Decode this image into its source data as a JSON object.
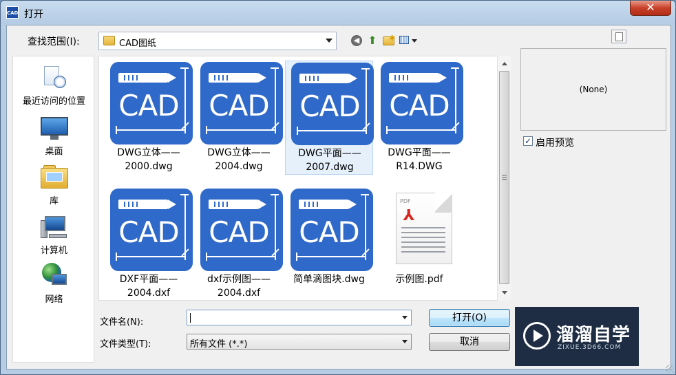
{
  "window": {
    "title": "打开",
    "icon_text": "CAD",
    "close_glyph": "✕"
  },
  "lookin": {
    "label": "查找范围(I):",
    "value": "CAD图纸"
  },
  "toolbar": {
    "back_glyph": "◀",
    "up_glyph": "⬆",
    "new_glyph": "✱"
  },
  "places": [
    {
      "label": "最近访问的位置",
      "icon": "recent-places-icon"
    },
    {
      "label": "桌面",
      "icon": "desktop-icon"
    },
    {
      "label": "库",
      "icon": "libraries-icon"
    },
    {
      "label": "计算机",
      "icon": "computer-icon"
    },
    {
      "label": "网络",
      "icon": "network-icon"
    }
  ],
  "files": [
    {
      "name": "DWG立体——\n2000.dwg",
      "type": "cad",
      "thumb_text": "CAD",
      "selected": false
    },
    {
      "name": "DWG立体——\n2004.dwg",
      "type": "cad",
      "thumb_text": "CAD",
      "selected": false
    },
    {
      "name": "DWG平面——\n2007.dwg",
      "type": "cad",
      "thumb_text": "CAD",
      "selected": true
    },
    {
      "name": "DWG平面——\nR14.DWG",
      "type": "cad",
      "thumb_text": "CAD",
      "selected": false
    },
    {
      "name": "DXF平面——\n2004.dxf",
      "type": "cad",
      "thumb_text": "CAD",
      "selected": false
    },
    {
      "name": "dxf示例图——\n2004.dxf",
      "type": "cad",
      "thumb_text": "CAD",
      "selected": false
    },
    {
      "name": "简单滴图块.dwg",
      "type": "cad",
      "thumb_text": "CAD",
      "selected": false
    },
    {
      "name": "示例图.pdf",
      "type": "pdf",
      "thumb_text": "PDF",
      "selected": false
    }
  ],
  "pdf_glyph": "⅄",
  "preview": {
    "none_text": "(None)",
    "checkbox_label": "启用预览",
    "checked": true,
    "check_glyph": "✓"
  },
  "filename": {
    "label": "文件名(N):",
    "value": ""
  },
  "filetype": {
    "label": "文件类型(T):",
    "value": "所有文件 (*.*)"
  },
  "buttons": {
    "open": "打开(O)",
    "cancel": "取消"
  },
  "watermark": {
    "title": "溜溜自学",
    "subtitle": "ZIXUE.3D66.COM"
  },
  "colors": {
    "cad_tile": "#2f69c9",
    "selection": "#e5f0fb",
    "titlebar": "#c9dcef",
    "close": "#c8412a"
  }
}
